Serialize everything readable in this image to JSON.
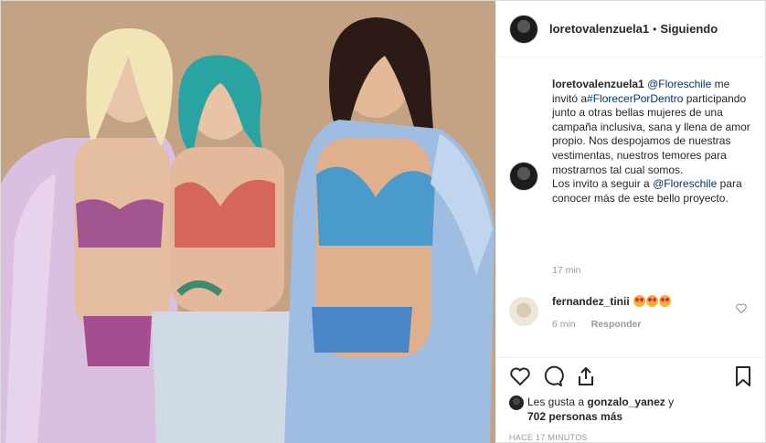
{
  "post": {
    "username": "loretovalenzuela1",
    "separator": "•",
    "follow_state": "Siguiendo"
  },
  "caption": {
    "username": "loretovalenzuela1",
    "mention1": "@Floreschile",
    "text1": " me invitó a",
    "hashtag": "#FlorecerPorDentro",
    "text2": " participando junto a otras bellas mujeres de una campaña inclusiva, sana y llena de amor propio. Nos despojamos de nuestras vestimentas, nuestros temores para mostrarnos tal cual somos.",
    "text3": "Los invito a seguir a ",
    "mention2": "@Floreschile",
    "text4": " para conocer más de este bello proyecto.",
    "time": "17 min"
  },
  "comment": {
    "username": "fernandez_tinii",
    "emoji_count": 3,
    "time": "6 min",
    "reply_label": "Responder"
  },
  "likes": {
    "prefix": "Les gusta a ",
    "user": "gonzalo_yanez",
    "mid": " y",
    "others": "702 personas más"
  },
  "posted_ago": "HACE 17 MINUTOS",
  "icons": [
    "heart-icon",
    "comment-icon",
    "share-icon",
    "bookmark-icon"
  ]
}
